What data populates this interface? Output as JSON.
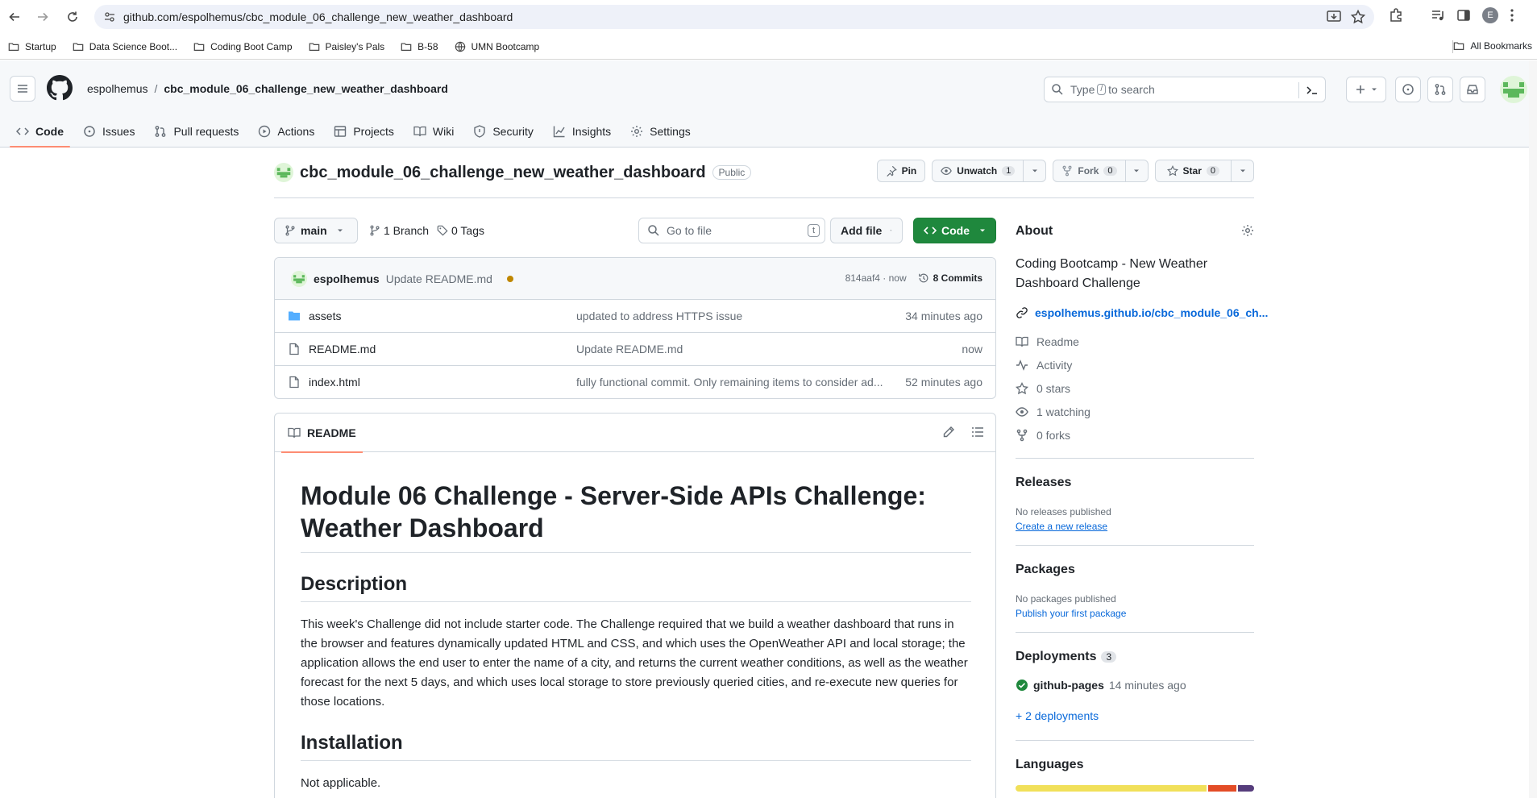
{
  "browser": {
    "url": "github.com/espolhemus/cbc_module_06_challenge_new_weather_dashboard",
    "profile_initial": "E",
    "bookmarks": [
      {
        "label": "Startup",
        "icon": "folder-icon"
      },
      {
        "label": "Data Science Boot...",
        "icon": "folder-icon"
      },
      {
        "label": "Coding Boot Camp",
        "icon": "folder-icon"
      },
      {
        "label": "Paisley's Pals",
        "icon": "folder-icon"
      },
      {
        "label": "B-58",
        "icon": "folder-icon"
      },
      {
        "label": "UMN Bootcamp",
        "icon": "globe-icon"
      }
    ],
    "all_bookmarks": "All Bookmarks"
  },
  "header": {
    "owner": "espolhemus",
    "separator": "/",
    "repo": "cbc_module_06_challenge_new_weather_dashboard",
    "search_placeholder_pre": "Type",
    "search_key": "/",
    "search_placeholder_post": "to search"
  },
  "tabs": [
    {
      "label": "Code",
      "icon": "code-icon",
      "active": true
    },
    {
      "label": "Issues",
      "icon": "issue-icon"
    },
    {
      "label": "Pull requests",
      "icon": "pull-request-icon"
    },
    {
      "label": "Actions",
      "icon": "play-icon"
    },
    {
      "label": "Projects",
      "icon": "table-icon"
    },
    {
      "label": "Wiki",
      "icon": "book-icon"
    },
    {
      "label": "Security",
      "icon": "shield-icon"
    },
    {
      "label": "Insights",
      "icon": "graph-icon"
    },
    {
      "label": "Settings",
      "icon": "gear-icon"
    }
  ],
  "repo": {
    "title": "cbc_module_06_challenge_new_weather_dashboard",
    "visibility": "Public",
    "pin": "Pin",
    "unwatch": "Unwatch",
    "watch_count": "1",
    "fork": "Fork",
    "fork_count": "0",
    "star": "Star",
    "star_count": "0"
  },
  "files_toolbar": {
    "branch": "main",
    "branches": "1 Branch",
    "tags": "0 Tags",
    "go_to_file": "Go to file",
    "go_to_file_key": "t",
    "add_file": "Add file",
    "code": "Code"
  },
  "commit": {
    "author": "espolhemus",
    "message": "Update README.md",
    "hash": "814aaf4 · now",
    "commits": "8 Commits"
  },
  "files": [
    {
      "name": "assets",
      "type": "folder",
      "message": "updated to address HTTPS issue",
      "age": "34 minutes ago"
    },
    {
      "name": "README.md",
      "type": "file",
      "message": "Update README.md",
      "age": "now"
    },
    {
      "name": "index.html",
      "type": "file",
      "message": "fully functional commit. Only remaining items to consider ad...",
      "age": "52 minutes ago"
    }
  ],
  "readme": {
    "tab": "README",
    "h1": "Module 06 Challenge - Server-Side APIs Challenge: Weather Dashboard",
    "description_heading": "Description",
    "description": "This week's Challenge did not include starter code. The Challenge required that we build a weather dashboard that runs in the browser and features dynamically updated HTML and CSS, and which uses the OpenWeather API and local storage; the application allows the end user to enter the name of a city, and returns the current weather conditions, as well as the weather forecast for the next 5 days, and which uses local storage to store previously queried cities, and re-execute new queries for those locations.",
    "installation_heading": "Installation",
    "installation": "Not applicable."
  },
  "about": {
    "heading": "About",
    "description": "Coding Bootcamp - New Weather Dashboard Challenge",
    "link": "espolhemus.github.io/cbc_module_06_ch...",
    "readme": "Readme",
    "activity": "Activity",
    "stars": "0 stars",
    "watching": "1 watching",
    "forks": "0 forks"
  },
  "releases": {
    "heading": "Releases",
    "none": "No releases published",
    "create": "Create a new release"
  },
  "packages": {
    "heading": "Packages",
    "none": "No packages published",
    "publish": "Publish your first package"
  },
  "deployments": {
    "heading": "Deployments",
    "count": "3",
    "env": "github-pages",
    "time": "14 minutes ago",
    "more": "+ 2 deployments"
  },
  "languages": {
    "heading": "Languages",
    "bar": [
      {
        "color": "#f1e05a",
        "share": 0.81
      },
      {
        "color": "#e34c26",
        "share": 0.12
      },
      {
        "color": "#563d7c",
        "share": 0.07
      }
    ]
  }
}
